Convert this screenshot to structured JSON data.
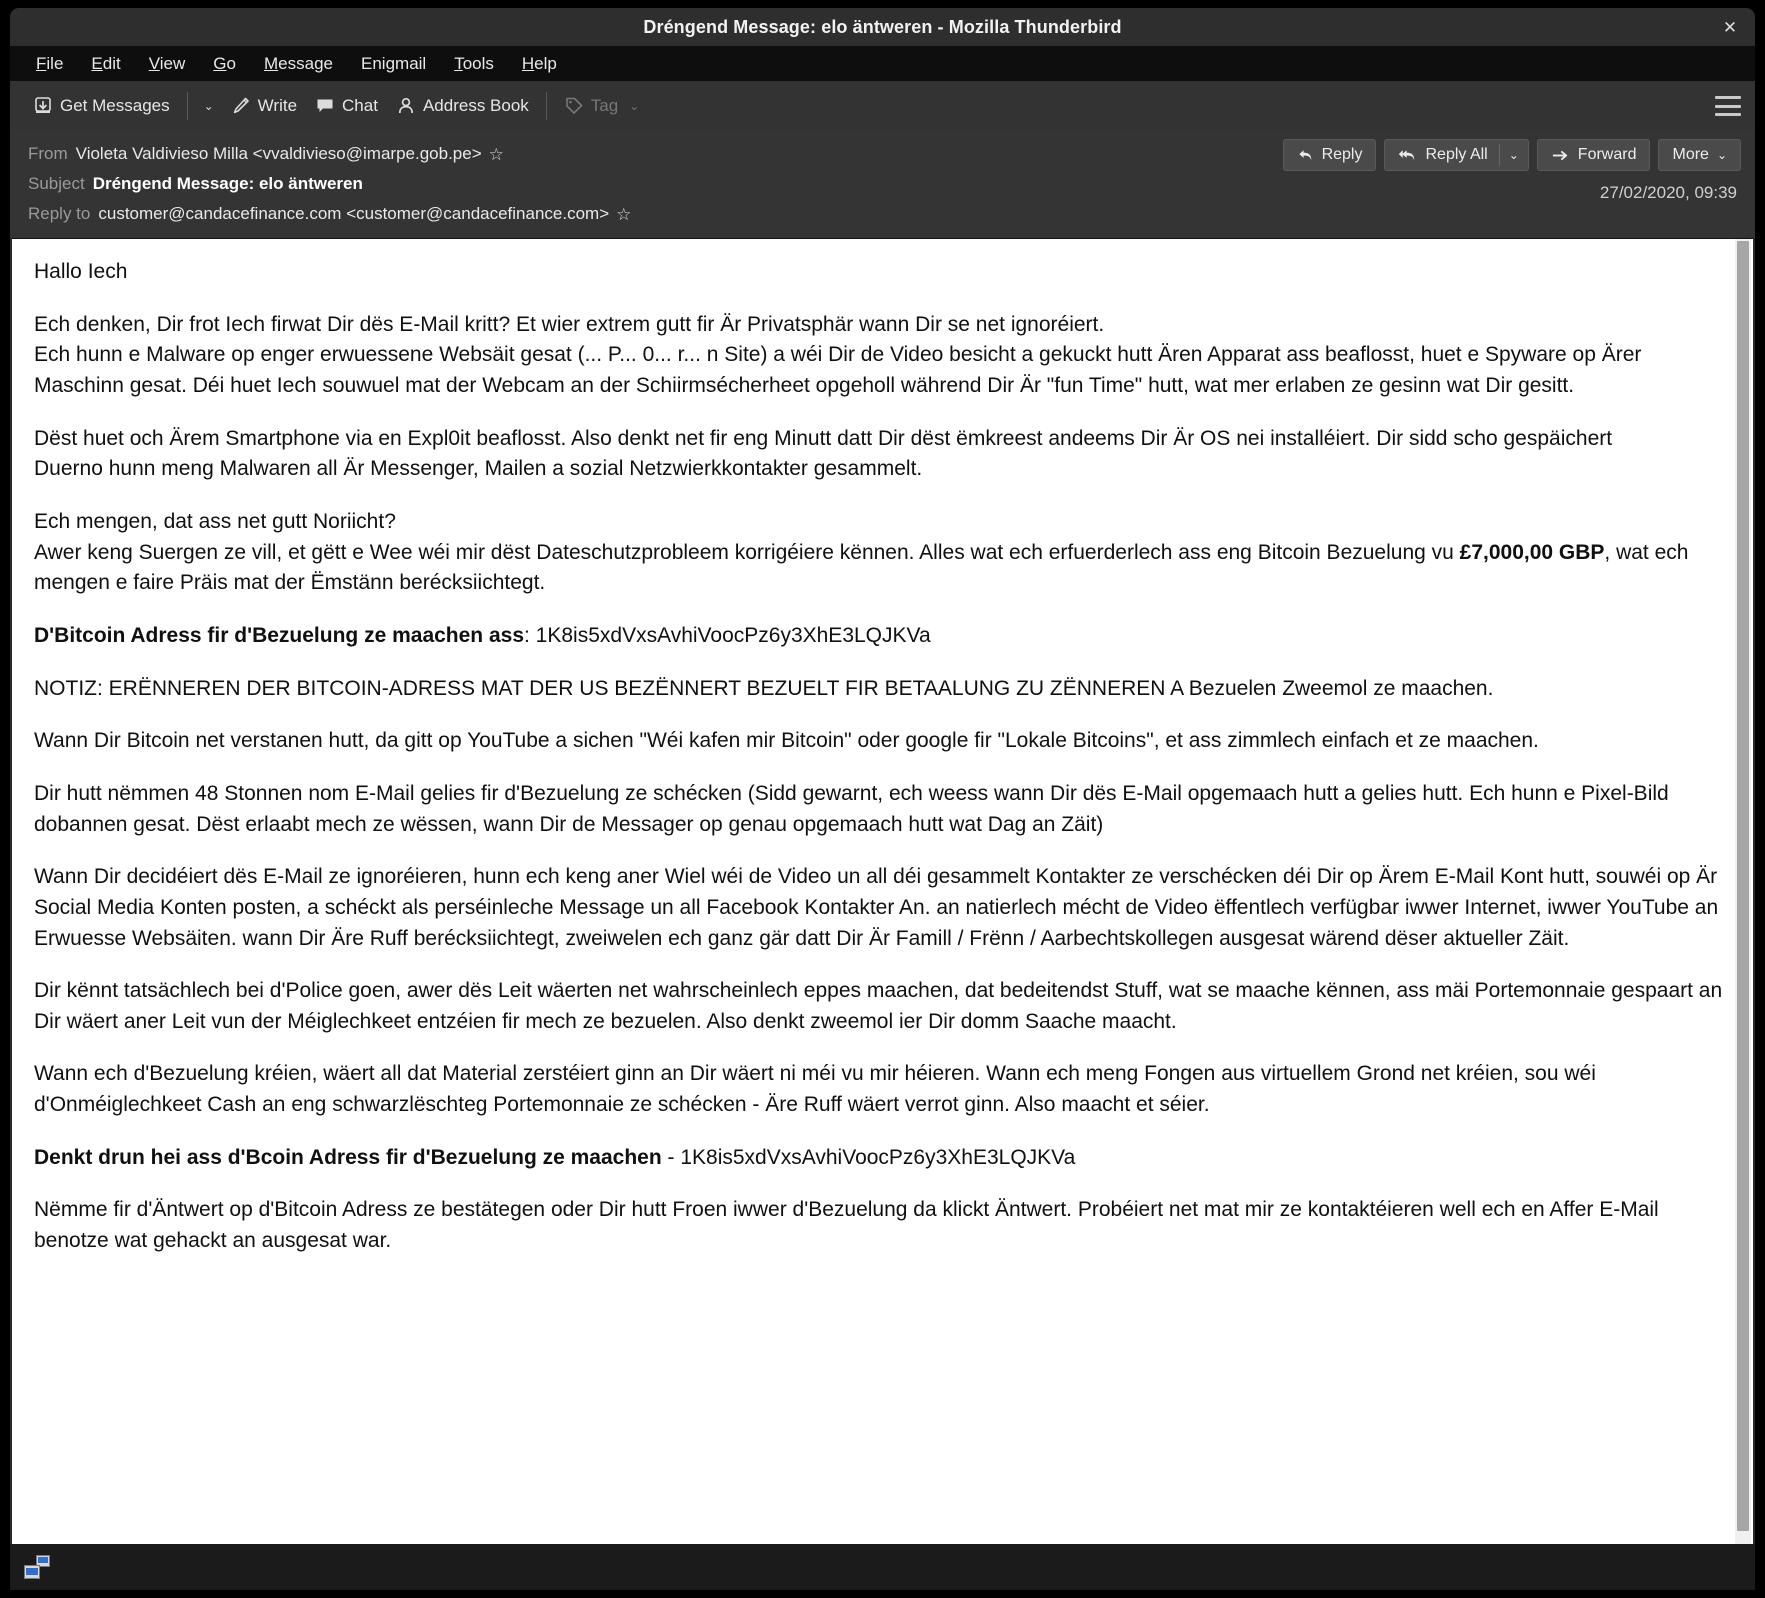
{
  "window": {
    "title": "Dréngend Message: elo äntweren - Mozilla Thunderbird",
    "close_label": "✕"
  },
  "menubar": {
    "items": [
      {
        "label": "File",
        "accel": "F"
      },
      {
        "label": "Edit",
        "accel": "E"
      },
      {
        "label": "View",
        "accel": "V"
      },
      {
        "label": "Go",
        "accel": "G"
      },
      {
        "label": "Message",
        "accel": "M"
      },
      {
        "label": "Enigmail",
        "accel": "g"
      },
      {
        "label": "Tools",
        "accel": "T"
      },
      {
        "label": "Help",
        "accel": "H"
      }
    ]
  },
  "toolbar": {
    "get_messages_label": "Get Messages",
    "get_messages_caret": "⌄",
    "write_label": "Write",
    "chat_label": "Chat",
    "address_book_label": "Address Book",
    "tag_label": "Tag",
    "tag_caret": "⌄",
    "app_menu_label": "Application Menu"
  },
  "message_header": {
    "from_label": "From",
    "from_value": "Violeta Valdivieso Milla <vvaldivieso@imarpe.gob.pe>",
    "from_star": "☆",
    "subject_label": "Subject",
    "subject_value": "Dréngend Message: elo äntweren",
    "reply_to_label": "Reply to",
    "reply_to_value": "customer@candacefinance.com <customer@candacefinance.com>",
    "reply_to_star": "☆",
    "date": "27/02/2020, 09:39",
    "actions": {
      "reply_label": "Reply",
      "reply_all_label": "Reply All",
      "reply_all_caret": "⌄",
      "forward_label": "Forward",
      "more_label": "More",
      "more_caret": "⌄"
    }
  },
  "body": {
    "greeting": "Hallo Iech",
    "p1_line1": "Ech denken, Dir frot Iech firwat Dir dës E-Mail kritt? Et wier extrem gutt fir Är Privatsphär wann Dir se net ignoréiert.",
    "p1_line2": "Ech hunn e Malware op enger erwuessene Websäit gesat (... P... 0... r... n Site) a wéi Dir de Video besicht a gekuckt hutt Ären Apparat ass beaflosst, huet e Spyware op Ärer Maschinn gesat. Déi huet Iech souwuel mat der Webcam an der Schiirmsécherheet opgeholl während Dir Är \"fun Time\" hutt, wat mer erlaben ze gesinn wat Dir gesitt.",
    "p2_line1": "Dëst huet och Ärem Smartphone via en Expl0it beaflosst. Also denkt net fir eng Minutt datt Dir dëst ëmkreest andeems Dir Är OS nei installéiert. Dir sidd scho gespäichert",
    "p2_line2": "Duerno hunn meng Malwaren all Är Messenger, Mailen a sozial Netzwierkkontakter gesammelt.",
    "p3_line1": "Ech mengen, dat ass net gutt Noriicht?",
    "p3_line2_a": "Awer keng Suergen ze vill, et gëtt e Wee wéi mir dëst Dateschutzprobleem korrigéiere kënnen. Alles wat ech erfuerderlech ass eng Bitcoin Bezuelung vu ",
    "p3_amount": "£7,000,00 GBP",
    "p3_line2_b": ", wat ech mengen e faire Präis mat der Ëmstänn berécksiichtegt.",
    "p4_bold": "D'Bitcoin Adress fir d'Bezuelung ze maachen ass",
    "p4_rest": ": 1K8is5xdVxsAvhiVoocPz6y3XhE3LQJKVa",
    "p5": "NOTIZ: ERËNNEREN DER BITCOIN-ADRESS MAT DER US BEZËNNERT BEZUELT FIR BETAALUNG ZU ZËNNEREN A Bezuelen Zweemol ze maachen.",
    "p6": "Wann Dir Bitcoin net verstanen hutt, da gitt op YouTube a sichen \"Wéi kafen mir Bitcoin\" oder google fir \"Lokale Bitcoins\", et ass zimmlech einfach et ze maachen.",
    "p7": "Dir hutt nëmmen 48 Stonnen nom E-Mail gelies fir d'Bezuelung ze schécken (Sidd gewarnt, ech weess wann Dir dës E-Mail opgemaach hutt a gelies hutt. Ech hunn e Pixel-Bild dobannen gesat. Dëst erlaabt mech ze wëssen, wann Dir de Messager op genau opgemaach hutt wat Dag an Zäit)",
    "p8": "Wann Dir decidéiert dës E-Mail ze ignoréieren, hunn ech keng aner Wiel wéi de Video un all déi gesammelt Kontakter ze verschécken déi Dir op Ärem E-Mail Kont hutt, souwéi op Är Social Media Konten posten, a schéckt als perséinleche Message un all Facebook Kontakter An. an natierlech mécht de Video ëffentlech verfügbar iwwer Internet, iwwer YouTube an Erwuesse Websäiten. wann Dir Äre Ruff berécksiichtegt, zweiwelen ech ganz gär datt Dir Är Famill / Frënn / Aarbechtskollegen ausgesat wärend dëser aktueller Zäit.",
    "p9": "Dir kënnt tatsächlech bei d'Police goen, awer dës Leit wäerten net wahrscheinlech eppes maachen, dat bedeitendst Stuff, wat se maache kënnen, ass mäi Portemonnaie gespaart an Dir wäert aner Leit vun der Méiglechkeet entzéien fir mech ze bezuelen. Also denkt zweemol ier Dir domm Saache maacht.",
    "p10": "Wann ech d'Bezuelung kréien, wäert all dat Material zerstéiert ginn an Dir wäert ni méi vu mir héieren. Wann ech meng Fongen aus virtuellem Grond net kréien, sou wéi d'Onméiglechkeet Cash an eng schwarzlëschteg Portemonnaie ze schécken - Äre Ruff wäert verrot ginn. Also maacht et séier.",
    "p11_bold": "Denkt drun hei ass d'Bcoin Adress fir d'Bezuelung ze maachen",
    "p11_rest": " - 1K8is5xdVxsAvhiVoocPz6y3XhE3LQJKVa",
    "p12": "Nëmme fir d'Äntwert op d'Bitcoin Adress ze bestätegen oder Dir hutt Froen iwwer d'Bezuelung da klickt Äntwert. Probéiert net mat mir ze kontaktéieren well ech en Affer E-Mail benotze wat gehackt an ausgesat war."
  },
  "statusbar": {
    "network_icon_label": "network-connection"
  },
  "colors": {
    "titlebar_bg": "#2e2e2e",
    "menubar_bg": "#0e0e0e",
    "toolbar_bg": "#333333",
    "header_bg": "#343434",
    "body_bg": "#ffffff",
    "statusbar_bg": "#1b1b1b",
    "button_bg": "#4a4a4a",
    "scrollbar_thumb": "#a6a6a6"
  }
}
